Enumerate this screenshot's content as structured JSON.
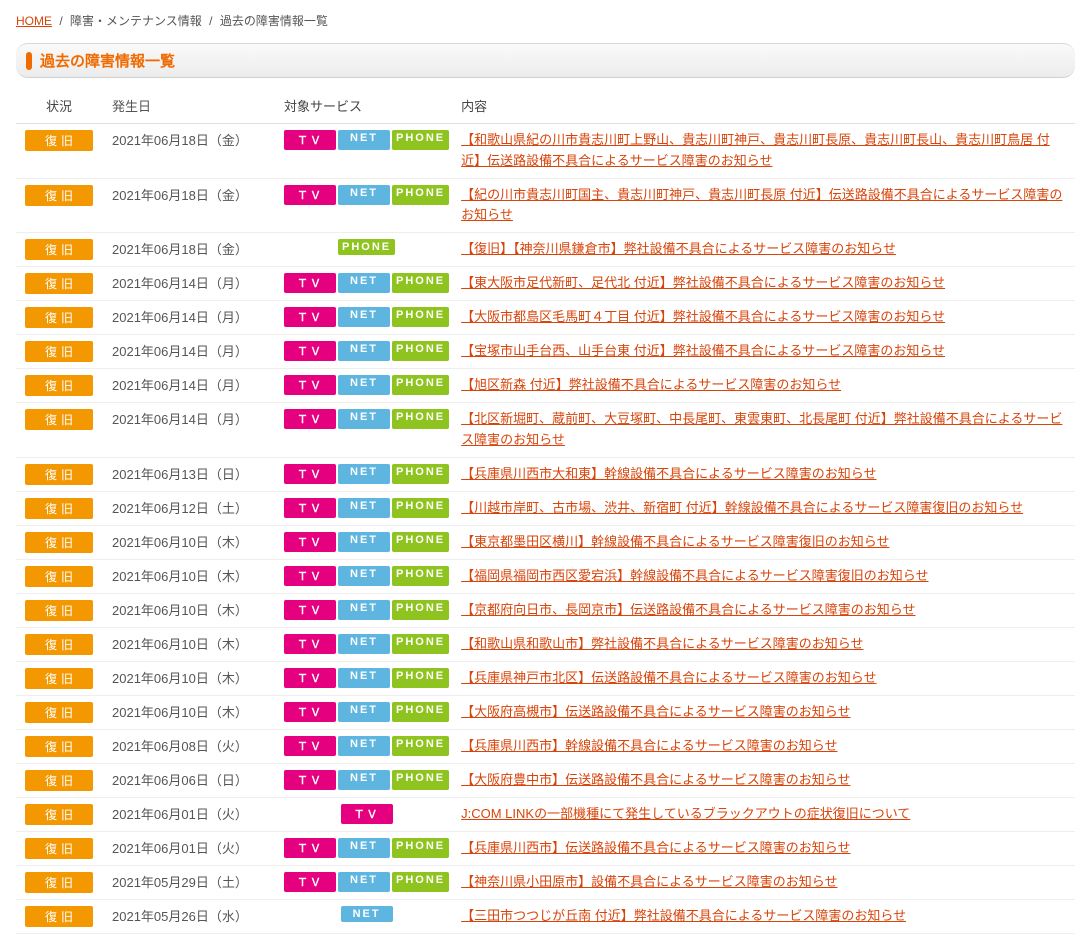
{
  "breadcrumb": {
    "home": "HOME",
    "mid": "障害・メンテナンス情報",
    "current": "過去の障害情報一覧"
  },
  "section_title": "過去の障害情報一覧",
  "columns": {
    "status": "状況",
    "date": "発生日",
    "service": "対象サービス",
    "content": "内容"
  },
  "status_labels": {
    "recovered": "復旧"
  },
  "service_labels": {
    "tv": "ＴＶ",
    "net": "NET",
    "phone": "PHONE"
  },
  "rows": [
    {
      "status": "recovered",
      "date": "2021年06月18日（金）",
      "services": [
        "tv",
        "net",
        "phone"
      ],
      "content": "【和歌山県紀の川市貴志川町上野山、貴志川町神戸、貴志川町長原、貴志川町長山、貴志川町鳥居 付近】伝送路設備不具合によるサービス障害のお知らせ"
    },
    {
      "status": "recovered",
      "date": "2021年06月18日（金）",
      "services": [
        "tv",
        "net",
        "phone"
      ],
      "content": "【紀の川市貴志川町国主、貴志川町神戸、貴志川町長原 付近】伝送路設備不具合によるサービス障害のお知らせ"
    },
    {
      "status": "recovered",
      "date": "2021年06月18日（金）",
      "services": [
        "phone"
      ],
      "content": "【復旧】【神奈川県鎌倉市】弊社設備不具合によるサービス障害のお知らせ"
    },
    {
      "status": "recovered",
      "date": "2021年06月14日（月）",
      "services": [
        "tv",
        "net",
        "phone"
      ],
      "content": "【東大阪市足代新町、足代北 付近】弊社設備不具合によるサービス障害のお知らせ"
    },
    {
      "status": "recovered",
      "date": "2021年06月14日（月）",
      "services": [
        "tv",
        "net",
        "phone"
      ],
      "content": "【大阪市都島区毛馬町４丁目 付近】弊社設備不具合によるサービス障害のお知らせ"
    },
    {
      "status": "recovered",
      "date": "2021年06月14日（月）",
      "services": [
        "tv",
        "net",
        "phone"
      ],
      "content": "【宝塚市山手台西、山手台東 付近】弊社設備不具合によるサービス障害のお知らせ"
    },
    {
      "status": "recovered",
      "date": "2021年06月14日（月）",
      "services": [
        "tv",
        "net",
        "phone"
      ],
      "content": "【旭区新森 付近】弊社設備不具合によるサービス障害のお知らせ"
    },
    {
      "status": "recovered",
      "date": "2021年06月14日（月）",
      "services": [
        "tv",
        "net",
        "phone"
      ],
      "content": "【北区新堀町、蔵前町、大豆塚町、中長尾町、東雲東町、北長尾町 付近】弊社設備不具合によるサービス障害のお知らせ"
    },
    {
      "status": "recovered",
      "date": "2021年06月13日（日）",
      "services": [
        "tv",
        "net",
        "phone"
      ],
      "content": "【兵庫県川西市大和東】幹線設備不具合によるサービス障害のお知らせ"
    },
    {
      "status": "recovered",
      "date": "2021年06月12日（土）",
      "services": [
        "tv",
        "net",
        "phone"
      ],
      "content": "【川越市岸町、古市場、渋井、新宿町 付近】幹線設備不具合によるサービス障害復旧のお知らせ"
    },
    {
      "status": "recovered",
      "date": "2021年06月10日（木）",
      "services": [
        "tv",
        "net",
        "phone"
      ],
      "content": "【東京都墨田区横川】幹線設備不具合によるサービス障害復旧のお知らせ"
    },
    {
      "status": "recovered",
      "date": "2021年06月10日（木）",
      "services": [
        "tv",
        "net",
        "phone"
      ],
      "content": "【福岡県福岡市西区愛宕浜】幹線設備不具合によるサービス障害復旧のお知らせ"
    },
    {
      "status": "recovered",
      "date": "2021年06月10日（木）",
      "services": [
        "tv",
        "net",
        "phone"
      ],
      "content": "【京都府向日市、長岡京市】伝送路設備不具合によるサービス障害のお知らせ"
    },
    {
      "status": "recovered",
      "date": "2021年06月10日（木）",
      "services": [
        "tv",
        "net",
        "phone"
      ],
      "content": "【和歌山県和歌山市】弊社設備不具合によるサービス障害のお知らせ"
    },
    {
      "status": "recovered",
      "date": "2021年06月10日（木）",
      "services": [
        "tv",
        "net",
        "phone"
      ],
      "content": "【兵庫県神戸市北区】伝送路設備不具合によるサービス障害のお知らせ"
    },
    {
      "status": "recovered",
      "date": "2021年06月10日（木）",
      "services": [
        "tv",
        "net",
        "phone"
      ],
      "content": "【大阪府高槻市】伝送路設備不具合によるサービス障害のお知らせ"
    },
    {
      "status": "recovered",
      "date": "2021年06月08日（火）",
      "services": [
        "tv",
        "net",
        "phone"
      ],
      "content": "【兵庫県川西市】幹線設備不具合によるサービス障害のお知らせ"
    },
    {
      "status": "recovered",
      "date": "2021年06月06日（日）",
      "services": [
        "tv",
        "net",
        "phone"
      ],
      "content": "【大阪府豊中市】伝送路設備不具合によるサービス障害のお知らせ"
    },
    {
      "status": "recovered",
      "date": "2021年06月01日（火）",
      "services": [
        "tv"
      ],
      "content": "J:COM LINKの一部機種にて発生しているブラックアウトの症状復旧について"
    },
    {
      "status": "recovered",
      "date": "2021年06月01日（火）",
      "services": [
        "tv",
        "net",
        "phone"
      ],
      "content": "【兵庫県川西市】伝送路設備不具合によるサービス障害のお知らせ"
    },
    {
      "status": "recovered",
      "date": "2021年05月29日（土）",
      "services": [
        "tv",
        "net",
        "phone"
      ],
      "content": "【神奈川県小田原市】設備不具合によるサービス障害のお知らせ"
    },
    {
      "status": "recovered",
      "date": "2021年05月26日（水）",
      "services": [
        "net"
      ],
      "content": "【三田市つつじが丘南 付近】弊社設備不具合によるサービス障害のお知らせ"
    }
  ]
}
